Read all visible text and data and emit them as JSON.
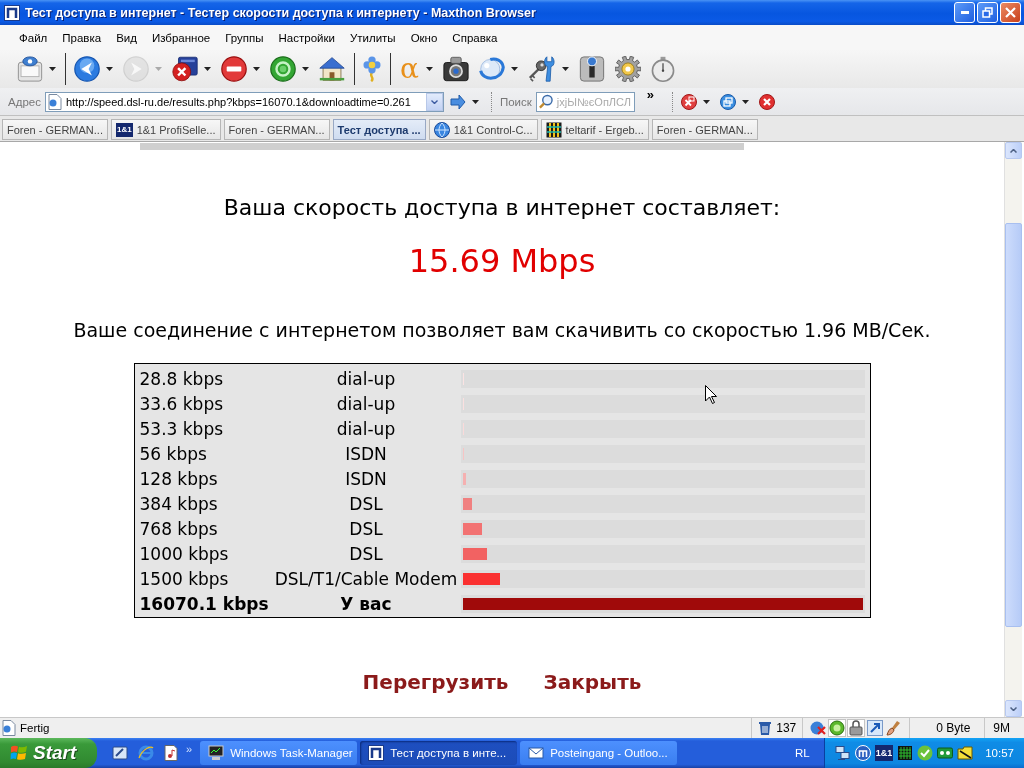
{
  "window": {
    "title": "Тест доступа в интернет - Тестер скорости доступа к интернету - Maxthon Browser"
  },
  "menu": [
    "Файл",
    "Правка",
    "Вид",
    "Избранное",
    "Группы",
    "Настройки",
    "Утилиты",
    "Окно",
    "Справка"
  ],
  "toolbar": {
    "groups": [
      [
        {
          "kind": "monitor",
          "dropdown": true,
          "disabled": false
        }
      ],
      [
        {
          "kind": "back",
          "dropdown": true,
          "disabled": false
        },
        {
          "kind": "forward",
          "dropdown": true,
          "disabled": true
        },
        {
          "kind": "close-window",
          "dropdown": true,
          "disabled": false
        },
        {
          "kind": "stop",
          "dropdown": true,
          "disabled": false
        },
        {
          "kind": "refresh",
          "dropdown": true,
          "disabled": false
        },
        {
          "kind": "home",
          "dropdown": false,
          "disabled": false
        }
      ],
      [
        {
          "kind": "flower",
          "dropdown": false,
          "disabled": false
        }
      ],
      [
        {
          "kind": "glyph",
          "text": "α",
          "dropdown": true,
          "disabled": false
        },
        {
          "kind": "camera",
          "dropdown": false,
          "disabled": false
        },
        {
          "kind": "swirl",
          "dropdown": true,
          "disabled": false
        },
        {
          "kind": "tools",
          "dropdown": true,
          "disabled": false
        },
        {
          "kind": "info",
          "dropdown": false,
          "disabled": false
        },
        {
          "kind": "gear",
          "dropdown": false,
          "disabled": false
        },
        {
          "kind": "stopwatch",
          "dropdown": false,
          "disabled": false
        }
      ]
    ]
  },
  "address_bar": {
    "label": "Адрес",
    "value": "http://speed.dsl-ru.de/results.php?kbps=16070.1&downloadtime=0.261",
    "search_label": "Поиск",
    "search_placeholder": "jxjЫ№єОпЛСЛ",
    "overflow": "»",
    "actions": [
      {
        "kind": "x-window",
        "dropdown": true
      },
      {
        "kind": "window-stack",
        "dropdown": true
      },
      {
        "kind": "x-circle",
        "dropdown": false
      }
    ]
  },
  "tabs": [
    {
      "label": "Foren - GERMAN...",
      "selected": false,
      "kind": "plain"
    },
    {
      "label": "1&1 ProfiSelle...",
      "selected": false,
      "kind": "badge",
      "badge": "1&1"
    },
    {
      "label": "Foren - GERMAN...",
      "selected": false,
      "kind": "plain"
    },
    {
      "label": "Тест доступа ...",
      "selected": true,
      "kind": "plain"
    },
    {
      "label": "1&1 Control-C...",
      "selected": false,
      "kind": "globe"
    },
    {
      "label": "teltarif - Ergeb...",
      "selected": false,
      "kind": "grid"
    },
    {
      "label": "Foren - GERMAN...",
      "selected": false,
      "kind": "plain"
    }
  ],
  "result": {
    "heading": "Ваша скорость доступа в интернет составляет:",
    "speed": "15.69 Mbps",
    "summary": "Ваше соединение с интернетом позволяет вам скачивить со скоростью 1.96 MB/Сек."
  },
  "comparison": [
    {
      "speed": "28.8 kbps",
      "type": "dial-up",
      "level": 0.0018,
      "color": "#fbe3e3",
      "kind": "reference"
    },
    {
      "speed": "33.6 kbps",
      "type": "dial-up",
      "level": 0.0021,
      "color": "#fbe0e0",
      "kind": "reference"
    },
    {
      "speed": "53.3 kbps",
      "type": "dial-up",
      "level": 0.0033,
      "color": "#fadada",
      "kind": "reference"
    },
    {
      "speed": "56 kbps",
      "type": "ISDN",
      "level": 0.0035,
      "color": "#f6c4c4",
      "kind": "reference"
    },
    {
      "speed": "128 kbps",
      "type": "ISDN",
      "level": 0.008,
      "color": "#f5b0b0",
      "kind": "reference"
    },
    {
      "speed": "384 kbps",
      "type": "DSL",
      "level": 0.024,
      "color": "#f08080",
      "kind": "reference"
    },
    {
      "speed": "768 kbps",
      "type": "DSL",
      "level": 0.048,
      "color": "#f27272",
      "kind": "reference"
    },
    {
      "speed": "1000 kbps",
      "type": "DSL",
      "level": 0.062,
      "color": "#f26262",
      "kind": "reference"
    },
    {
      "speed": "1500 kbps",
      "type": "DSL/T1/Cable Modem",
      "level": 0.093,
      "color": "#fa3030",
      "kind": "reference"
    },
    {
      "speed": "16070.1 kbps",
      "type": "У вас",
      "level": 1,
      "color": "#a00a0a",
      "kind": "result"
    }
  ],
  "actions": [
    "Перегрузить",
    "Закрыть"
  ],
  "status_bar": {
    "text": "Fertig",
    "trash_count": "137",
    "icons": [
      {
        "kind": "globe-blocked",
        "on": false
      },
      {
        "kind": "green-ring",
        "on": true
      },
      {
        "kind": "lock",
        "on": true
      },
      {
        "kind": "arrow",
        "on": false
      },
      {
        "kind": "brush",
        "on": false
      }
    ],
    "size": "0 Byte",
    "memory": "9M"
  },
  "taskbar": {
    "start": "Start",
    "quick_launch": [
      {
        "kind": "desktop"
      },
      {
        "kind": "browser"
      },
      {
        "kind": "media"
      }
    ],
    "overflow": "»",
    "tasks": [
      {
        "label": "Windows Task-Manager",
        "selected": false,
        "kind": "monitor"
      },
      {
        "label": "Тест доступа в инте...",
        "selected": true,
        "kind": "app"
      },
      {
        "label": "Posteingang - Outloo...",
        "selected": false,
        "kind": "mail"
      }
    ],
    "language": "RL",
    "tray": [
      {
        "kind": "network"
      },
      {
        "kind": "app"
      },
      {
        "kind": "badge",
        "text": "1&1"
      },
      {
        "kind": "green-grid"
      },
      {
        "kind": "shield"
      },
      {
        "kind": "green-device"
      },
      {
        "kind": "folder"
      }
    ],
    "clock": "10:57"
  }
}
